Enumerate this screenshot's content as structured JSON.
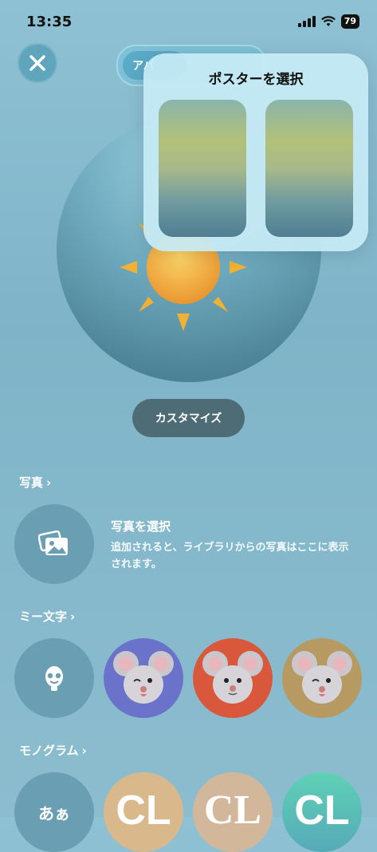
{
  "status_bar": {
    "time": "13:35",
    "battery": "79"
  },
  "top_tab": {
    "label": "アバ"
  },
  "popover": {
    "title": "ポスターを選択"
  },
  "customize_label": "カスタマイズ",
  "sections": {
    "photos": {
      "header": "写真",
      "select_title": "写真を選択",
      "description": "追加されると、ライブラリからの写真はここに表示されます。"
    },
    "memoji": {
      "header": "ミー文字"
    },
    "monogram": {
      "header": "モノグラム",
      "text_label": "あぁ",
      "initials": [
        "CL",
        "CL",
        "CL"
      ]
    }
  },
  "colors": {
    "memoji_bg": [
      "#6a73c9",
      "#d9583c",
      "#b69a62"
    ],
    "monogram_bg": [
      "#d9b98b",
      "#d3b79b",
      "#5fc1b2"
    ]
  },
  "icons": [
    "close-icon",
    "photo-stack-icon",
    "memoji-face-icon",
    "chevron-right-icon",
    "signal-icon",
    "wifi-icon",
    "battery-icon",
    "sun-icon",
    "mouse-memoji-icon"
  ]
}
